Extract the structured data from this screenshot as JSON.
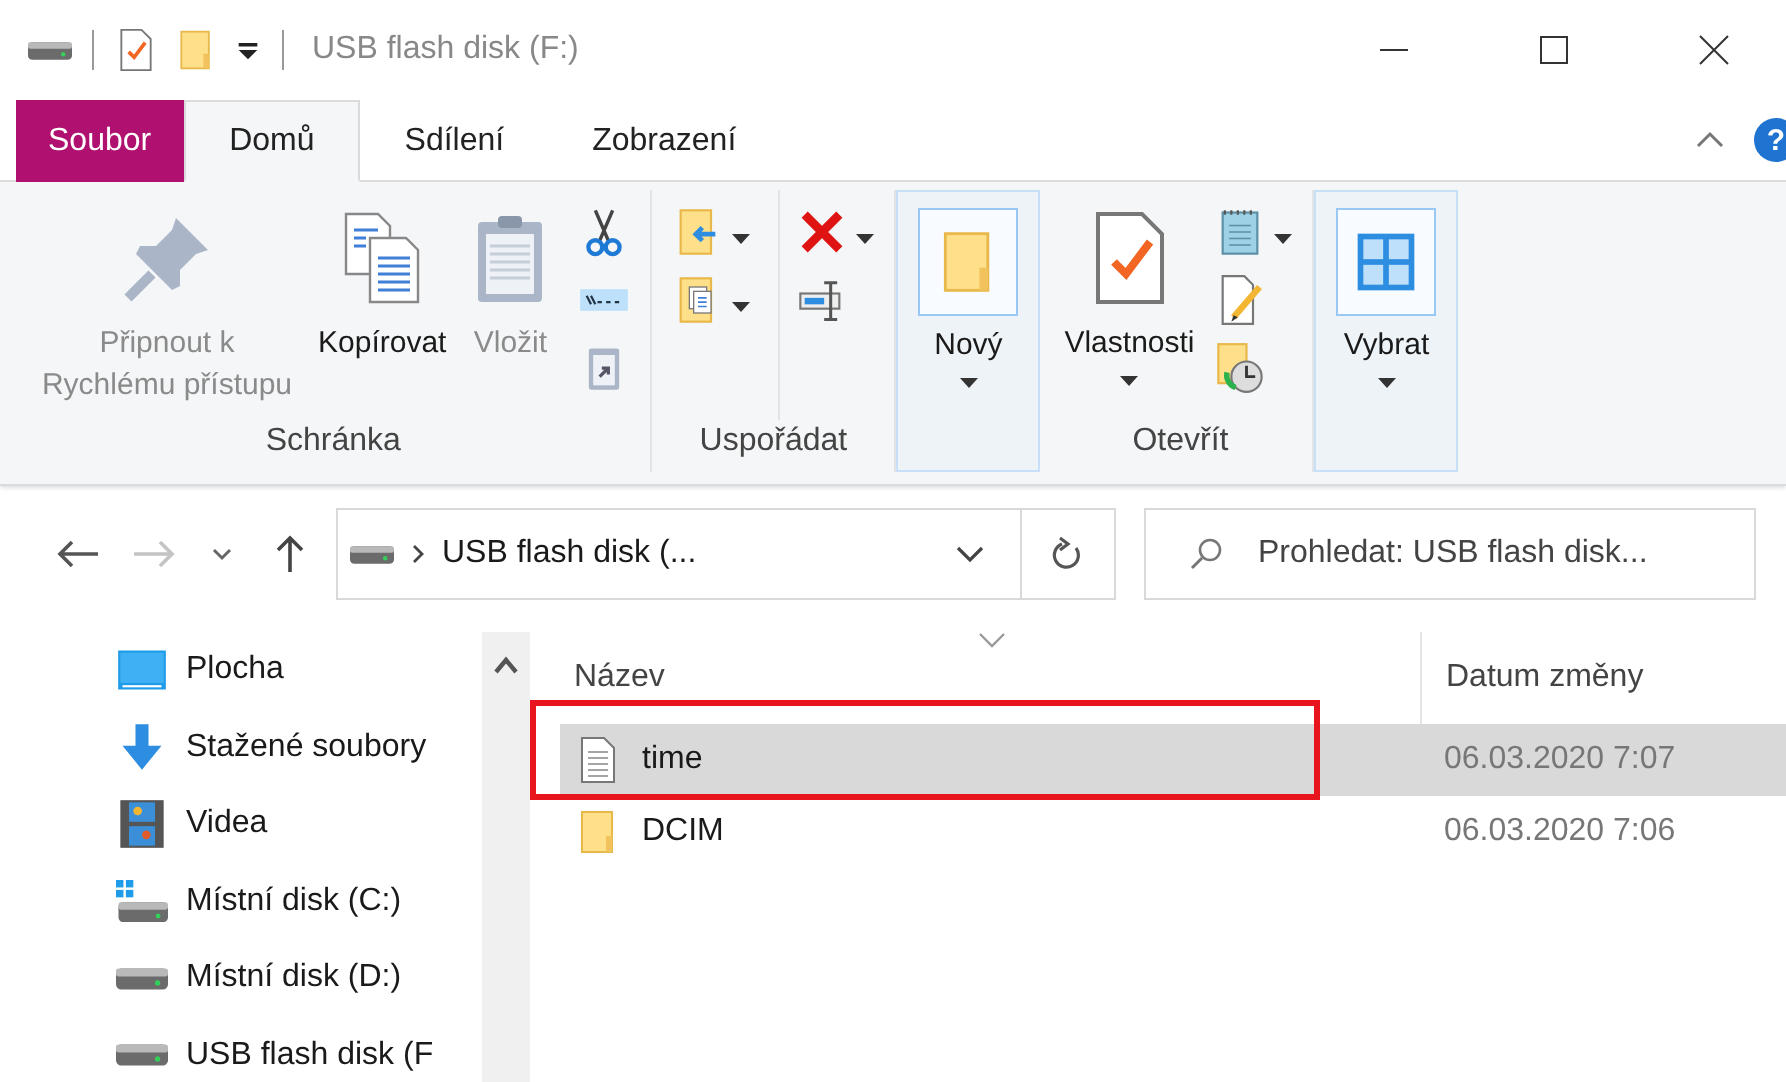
{
  "window": {
    "title": "USB flash disk (F:)",
    "help": "?"
  },
  "tabs": [
    {
      "label": "Soubor",
      "kind": "file",
      "selected": false
    },
    {
      "label": "Domů",
      "kind": "tab",
      "selected": true
    },
    {
      "label": "Sdílení",
      "kind": "tab",
      "selected": false
    },
    {
      "label": "Zobrazení",
      "kind": "tab",
      "selected": false
    }
  ],
  "ribbon": {
    "groups": [
      {
        "label": "Schránka",
        "items": [
          {
            "label": "Připnout k Rychlému přístupu",
            "disabled": true,
            "highlighted": false,
            "dropdown": false
          },
          {
            "label": "Kopírovat",
            "disabled": false,
            "highlighted": false,
            "dropdown": false
          },
          {
            "label": "Vložit",
            "disabled": true,
            "highlighted": false,
            "dropdown": false
          }
        ]
      },
      {
        "label": "Uspořádat"
      },
      {
        "items": [
          {
            "label": "Nový",
            "disabled": false,
            "highlighted": true,
            "dropdown": true
          }
        ]
      },
      {
        "label": "Otevřít",
        "items": [
          {
            "label": "Vlastnosti",
            "disabled": false,
            "highlighted": false,
            "dropdown": true
          }
        ]
      },
      {
        "items": [
          {
            "label": "Vybrat",
            "disabled": false,
            "highlighted": true,
            "dropdown": true
          }
        ]
      }
    ]
  },
  "address": {
    "path": "USB flash disk (...",
    "back_disabled": false,
    "forward_disabled": true
  },
  "search": {
    "placeholder": "Prohledat: USB flash disk..."
  },
  "sidebar": {
    "items": [
      {
        "kind": "desktop",
        "label": "Plocha"
      },
      {
        "kind": "download",
        "label": "Stažené soubory"
      },
      {
        "kind": "video",
        "label": "Videa"
      },
      {
        "kind": "sysdrive",
        "label": "Místní disk (C:)"
      },
      {
        "kind": "drive",
        "label": "Místní disk (D:)"
      },
      {
        "kind": "drive",
        "label": "USB flash disk (F"
      }
    ]
  },
  "table": {
    "columns": [
      "Název",
      "Datum změny"
    ],
    "rows": [
      {
        "kind": "text",
        "name": "time",
        "date": "06.03.2020 7:07",
        "selected": true,
        "marked": true
      },
      {
        "kind": "folder",
        "name": "DCIM",
        "date": "06.03.2020 7:06",
        "selected": false,
        "marked": false
      }
    ]
  }
}
